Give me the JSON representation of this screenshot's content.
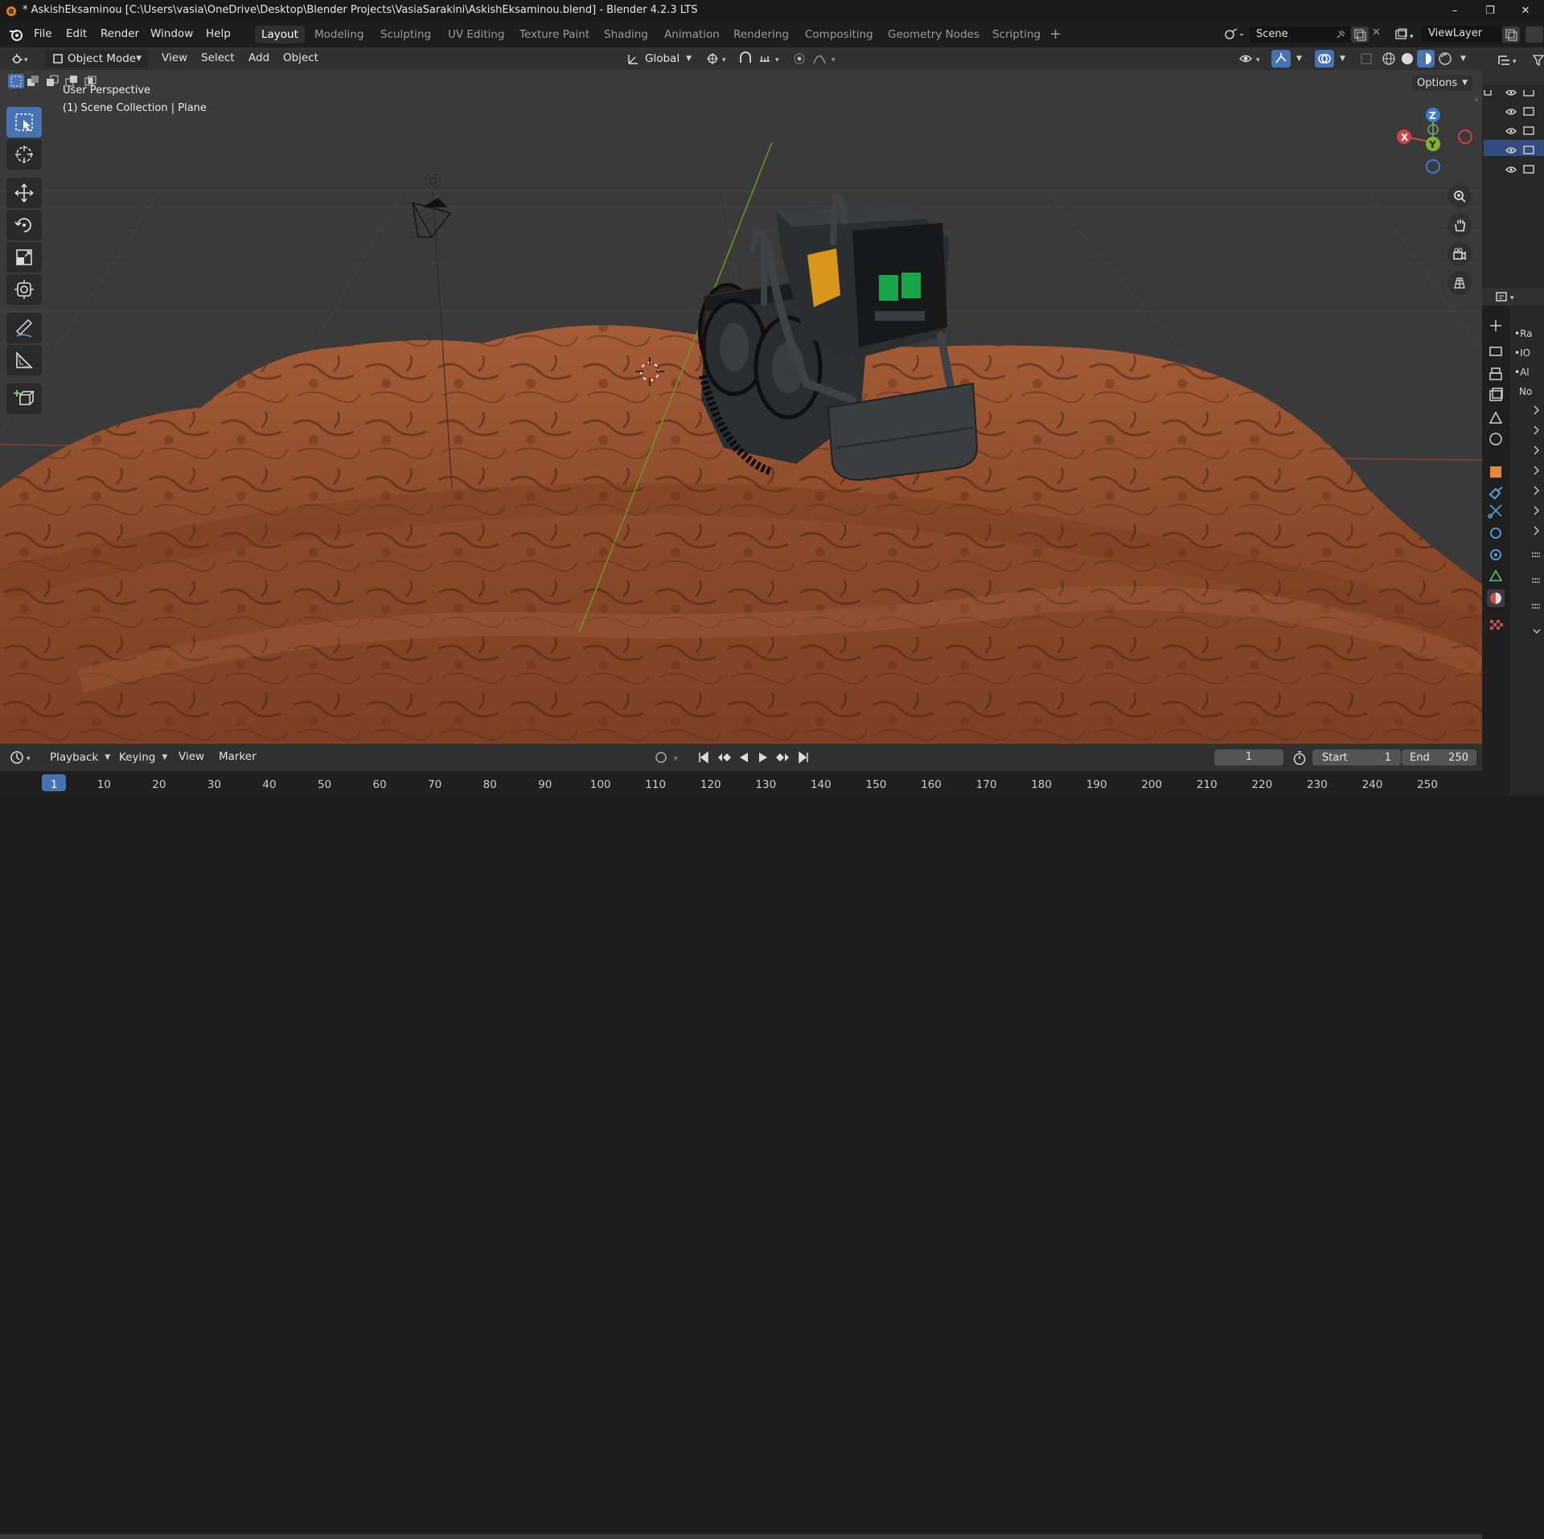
{
  "window": {
    "title": "* AskishEksaminou [C:\\Users\\vasia\\OneDrive\\Desktop\\Blender Projects\\VasiaSarakini\\AskishEksaminou.blend] - Blender 4.2.3 LTS",
    "minimize": "–",
    "maximize": "❐",
    "close": "✕"
  },
  "menu": [
    "File",
    "Edit",
    "Render",
    "Window",
    "Help"
  ],
  "workspaces": [
    "Layout",
    "Modeling",
    "Sculpting",
    "UV Editing",
    "Texture Paint",
    "Shading",
    "Animation",
    "Rendering",
    "Compositing",
    "Geometry Nodes",
    "Scripting"
  ],
  "active_workspace": "Layout",
  "scene": {
    "name": "Scene",
    "view_layer": "ViewLayer"
  },
  "viewport_header": {
    "mode": "Object Mode",
    "menus": [
      "View",
      "Select",
      "Add",
      "Object"
    ],
    "orientation": "Global",
    "options": "Options"
  },
  "viewport": {
    "perspective": "User Perspective",
    "collection": "(1) Scene Collection | Plane",
    "gizmo": {
      "x": "X",
      "y": "Y",
      "z": "Z"
    }
  },
  "tools": [
    "select-box-icon",
    "cursor-icon",
    "move-icon",
    "rotate-icon",
    "scale-icon",
    "transform-icon",
    "annotate-icon",
    "measure-icon",
    "add-cube-icon"
  ],
  "outliner_rows": 5,
  "properties_labels": [
    "•Ra",
    "•IO",
    "•Al",
    "No"
  ],
  "timeline": {
    "menus": [
      "Playback",
      "Keying",
      "View",
      "Marker"
    ],
    "current_frame": "1",
    "start_label": "Start",
    "start": "1",
    "end_label": "End",
    "end": "250",
    "ticks": [
      "1",
      "10",
      "20",
      "30",
      "40",
      "50",
      "60",
      "70",
      "80",
      "90",
      "100",
      "110",
      "120",
      "130",
      "140",
      "150",
      "160",
      "170",
      "180",
      "190",
      "200",
      "210",
      "220",
      "230",
      "240",
      "250"
    ]
  },
  "colors": {
    "accent": "#4772b3",
    "terrain": "#8a4a2a",
    "robot_body": "#2c2f31",
    "robot_eyes": "#19a54a",
    "robot_accent": "#d9961c"
  }
}
